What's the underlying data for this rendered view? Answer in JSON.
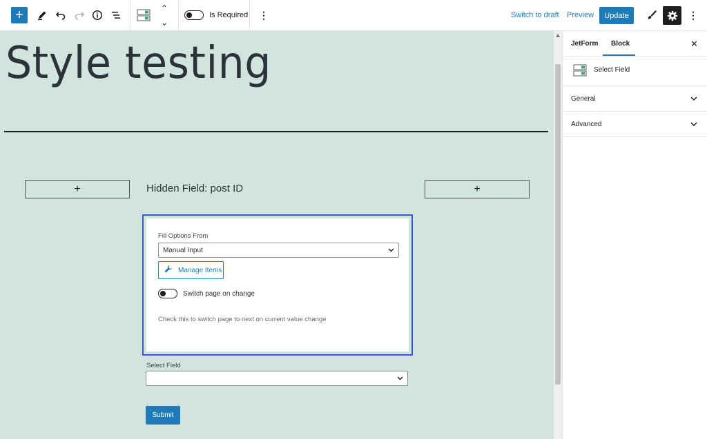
{
  "toolbar": {
    "add_label": "+",
    "is_required_label": "Is Required",
    "switch_to_draft": "Switch to draft",
    "preview": "Preview",
    "update": "Update",
    "more": "⋮",
    "accent_color": "#1e7ab8"
  },
  "icons": {
    "pencil": "pencil-icon",
    "undo": "undo-icon",
    "redo": "redo-icon",
    "info": "info-icon",
    "list_view": "list-view-icon",
    "select_field": "select-field-icon",
    "brush": "brush-icon",
    "gear": "gear-icon",
    "wrench": "wrench-icon"
  },
  "canvas": {
    "background": "#d2e4de",
    "page_title": "Style testing",
    "plus_left": "+",
    "plus_right": "+",
    "hidden_field_label": "Hidden Field: post ID",
    "select_block": {
      "fill_options_label": "Fill Options From",
      "fill_options_value": "Manual Input",
      "manage_items_label": "Manage Items",
      "switch_page_label": "Switch page on change",
      "help_text": "Check this to switch page to next on current value change"
    },
    "select_field_label": "Select Field",
    "select_field_value": "",
    "submit_label": "Submit"
  },
  "sidebar": {
    "tabs": [
      {
        "label": "JetForm",
        "active": false
      },
      {
        "label": "Block",
        "active": true
      }
    ],
    "close": "✕",
    "block_name": "Select Field",
    "panels": [
      {
        "label": "General"
      },
      {
        "label": "Advanced"
      }
    ]
  }
}
